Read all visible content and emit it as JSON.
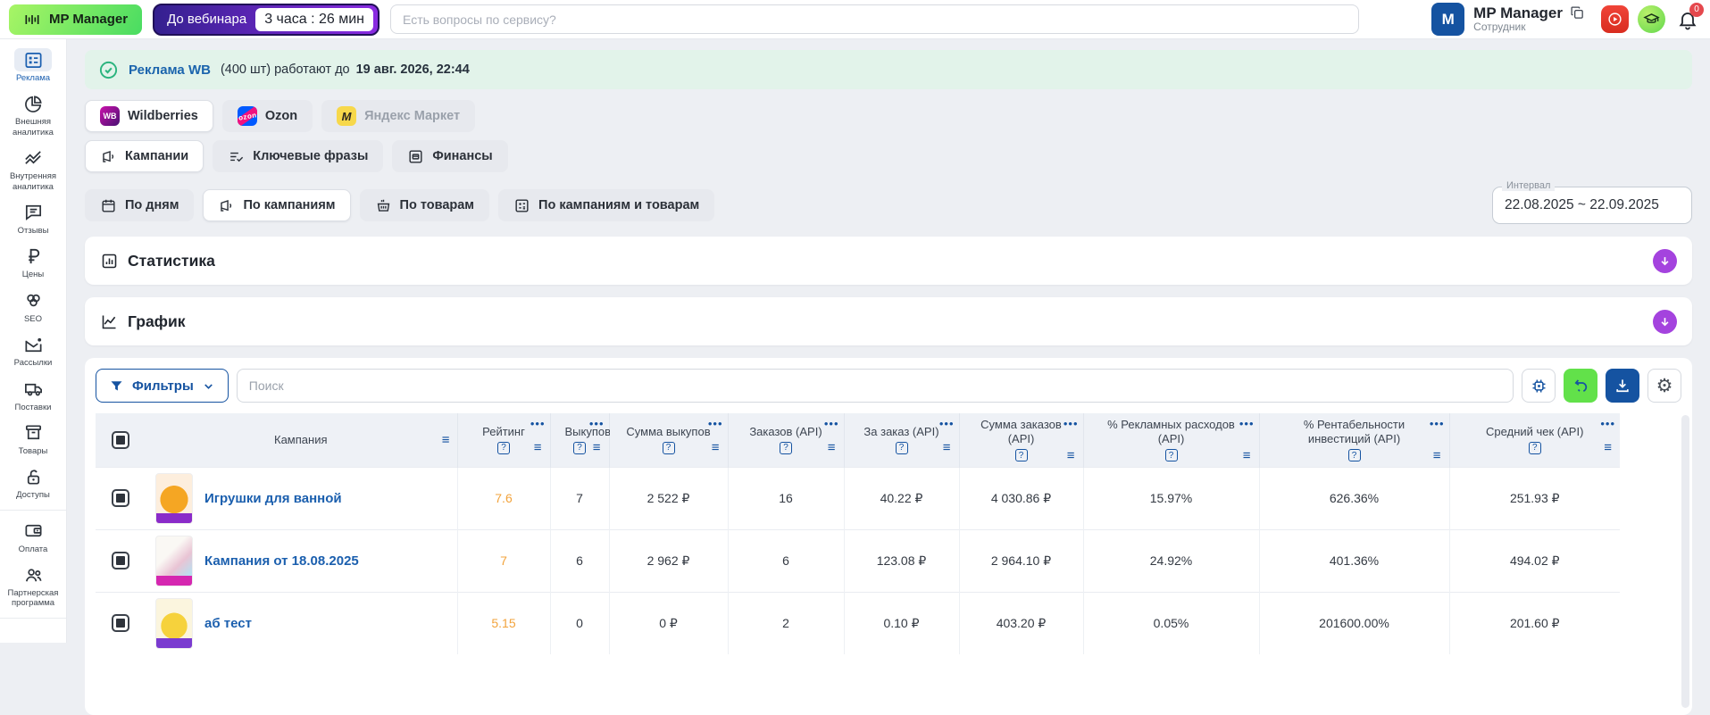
{
  "header": {
    "brand": "MP Manager",
    "webinar_label": "До вебинара",
    "webinar_countdown": "3 часа : 26 мин",
    "search_placeholder": "Есть вопросы по сервису?",
    "user_initial": "M",
    "user_name": "MP Manager",
    "user_role": "Сотрудник",
    "bell_badge": "0"
  },
  "sidebar": {
    "items": [
      {
        "label": "Реклама",
        "active": true
      },
      {
        "label": "Внешняя аналитика"
      },
      {
        "label": "Внутренняя аналитика"
      },
      {
        "label": "Отзывы"
      },
      {
        "label": "Цены"
      },
      {
        "label": "SEO"
      },
      {
        "label": "Рассылки"
      },
      {
        "label": "Поставки"
      },
      {
        "label": "Товары"
      },
      {
        "label": "Доступы"
      },
      {
        "label": "Оплата"
      },
      {
        "label": "Партнерская программа"
      }
    ]
  },
  "main": {
    "banner": {
      "link": "Реклама WB",
      "middle": "(400 шт) работают до",
      "date": "19 авг. 2026, 22:44"
    },
    "marketplaces": [
      {
        "label": "Wildberries"
      },
      {
        "label": "Ozon"
      },
      {
        "label": "Яндекс Маркет"
      }
    ],
    "module_tabs": [
      {
        "label": "Кампании"
      },
      {
        "label": "Ключевые фразы"
      },
      {
        "label": "Финансы"
      }
    ],
    "view_tabs": [
      {
        "label": "По дням"
      },
      {
        "label": "По кампаниям"
      },
      {
        "label": "По товарам"
      },
      {
        "label": "По кампаниям и товарам"
      }
    ],
    "interval": {
      "label": "Интервал",
      "value": "22.08.2025 ~ 22.09.2025"
    },
    "sections": [
      {
        "title": "Статистика"
      },
      {
        "title": "График"
      }
    ],
    "toolbar": {
      "filters_label": "Фильтры",
      "search_placeholder": "Поиск"
    },
    "table": {
      "columns": [
        "Кампания",
        "Рейтинг",
        "Выкупов",
        "Сумма выкупов",
        "Заказов (API)",
        "За заказ (API)",
        "Сумма заказов (API)",
        "% Рекламных расходов (API)",
        "% Рентабельности инвестиций (API)",
        "Средний чек (API)"
      ],
      "rows": [
        {
          "name": "Игрушки для ванной",
          "rating": "7.6",
          "buyouts": "7",
          "buyout_sum": "2 522 ₽",
          "orders": "16",
          "per_order": "40.22 ₽",
          "orders_sum": "4 030.86 ₽",
          "ad_spend_pct": "15.97%",
          "roi_pct": "626.36%",
          "avg_check": "251.93 ₽"
        },
        {
          "name": "Кампания от 18.08.2025",
          "rating": "7",
          "buyouts": "6",
          "buyout_sum": "2 962 ₽",
          "orders": "6",
          "per_order": "123.08 ₽",
          "orders_sum": "2 964.10 ₽",
          "ad_spend_pct": "24.92%",
          "roi_pct": "401.36%",
          "avg_check": "494.02 ₽"
        },
        {
          "name": "аб тест",
          "rating": "5.15",
          "buyouts": "0",
          "buyout_sum": "0 ₽",
          "orders": "2",
          "per_order": "0.10 ₽",
          "orders_sum": "403.20 ₽",
          "ad_spend_pct": "0.05%",
          "roi_pct": "201600.00%",
          "avg_check": "201.60 ₽"
        }
      ]
    }
  },
  "colors": {
    "brand_blue": "#1553a1",
    "accent_green": "#62e14a",
    "accent_purple": "#a443de",
    "rating_orange": "#f2a33c",
    "banner_green_bg": "#e2f3ea",
    "link_blue": "#1b64ad"
  }
}
